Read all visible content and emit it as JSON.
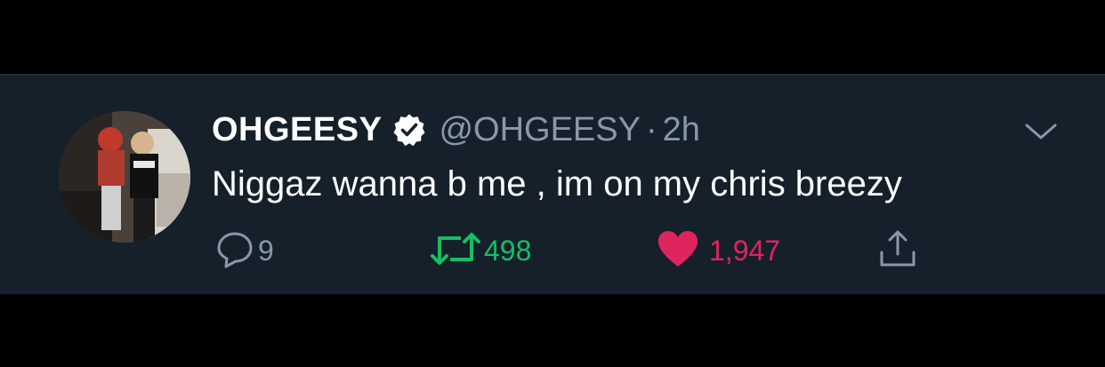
{
  "tweet": {
    "display_name": "OHGEESY",
    "verified": true,
    "handle": "@OHGEESY",
    "separator": "·",
    "time": "2h",
    "text": "Niggaz wanna b me , im on my chris breezy"
  },
  "actions": {
    "reply": {
      "icon": "reply-icon",
      "count": "9"
    },
    "retweet": {
      "icon": "retweet-icon",
      "count": "498",
      "active": true
    },
    "like": {
      "icon": "heart-icon",
      "count": "1,947",
      "active": true
    },
    "share": {
      "icon": "share-icon"
    }
  },
  "colors": {
    "background": "#000000",
    "tweet_background": "#15202b",
    "primary_text": "#ffffff",
    "secondary_text": "#8899a6",
    "retweet_active": "#17bf63",
    "like_active": "#e0245e"
  }
}
